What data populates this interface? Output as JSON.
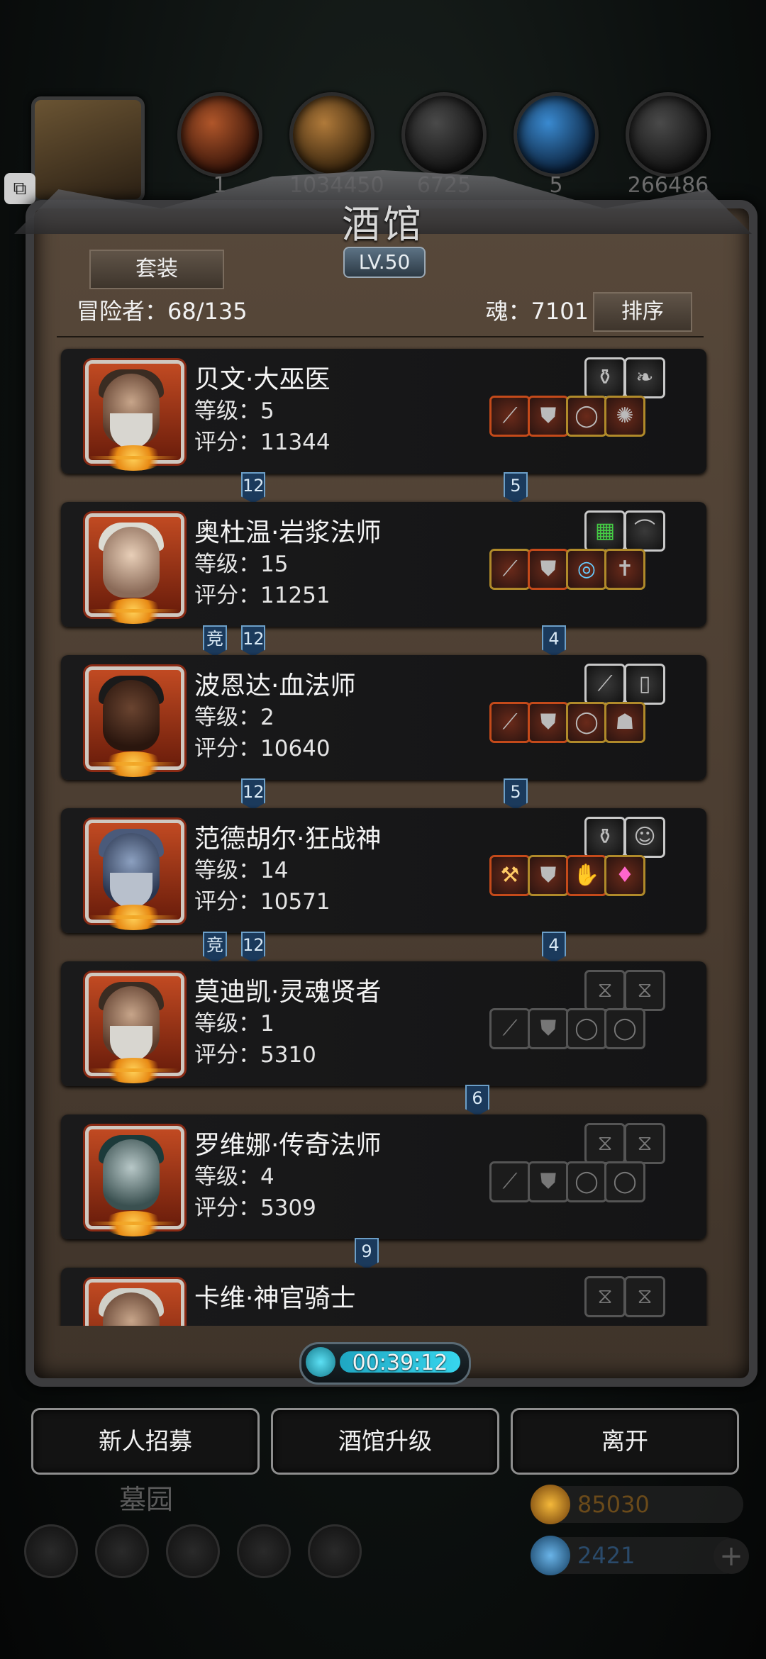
{
  "resources": [
    {
      "icon": "hero-hood-icon",
      "value": ""
    },
    {
      "icon": "meat-icon",
      "value": "1"
    },
    {
      "icon": "wood-icon",
      "value": "1034450"
    },
    {
      "icon": "stone-icon",
      "value": "6725"
    },
    {
      "icon": "crystal-icon",
      "value": "5"
    },
    {
      "icon": "iron-icon",
      "value": "266486"
    }
  ],
  "panel": {
    "title": "酒馆",
    "level": "LV.50",
    "suit_button": "套装",
    "adventurers_label": "冒险者：68/135",
    "soul_label": "魂：7101",
    "sort_button": "排序"
  },
  "heroes": [
    {
      "name": "贝文·大巫医",
      "level": "等级：5",
      "score": "评分：11344",
      "tags_left": [
        "12"
      ],
      "tag_right": "5",
      "filled": true
    },
    {
      "name": "奥杜温·岩浆法师",
      "level": "等级：15",
      "score": "评分：11251",
      "tags_left": [
        "竞",
        "12"
      ],
      "tag_right": "4",
      "filled": true
    },
    {
      "name": "波恩达·血法师",
      "level": "等级：2",
      "score": "评分：10640",
      "tags_left": [
        "12"
      ],
      "tag_right": "5",
      "filled": true
    },
    {
      "name": "范德胡尔·狂战神",
      "level": "等级：14",
      "score": "评分：10571",
      "tags_left": [
        "竞",
        "12"
      ],
      "tag_right": "4",
      "filled": true
    },
    {
      "name": "莫迪凯·灵魂贤者",
      "level": "等级：1",
      "score": "评分：5310",
      "tags_left": [],
      "tag_right": "6",
      "filled": false
    },
    {
      "name": "罗维娜·传奇法师",
      "level": "等级：4",
      "score": "评分：5309",
      "tags_left": [],
      "tag_right": "9",
      "filled": false
    },
    {
      "name": "卡维·神官骑士",
      "level": "",
      "score": "",
      "tags_left": [],
      "tag_right": "",
      "filled": false
    }
  ],
  "timer": "00:39:12",
  "buttons": {
    "recruit": "新人招募",
    "upgrade": "酒馆升级",
    "leave": "离开"
  },
  "background_label": "墓园",
  "currency": {
    "gold": "85030",
    "gems": "2421"
  },
  "colors": {
    "accent_gold": "#b08a2a",
    "tag_blue": "#1b3a5c",
    "timer_cyan": "#37d6ee"
  }
}
